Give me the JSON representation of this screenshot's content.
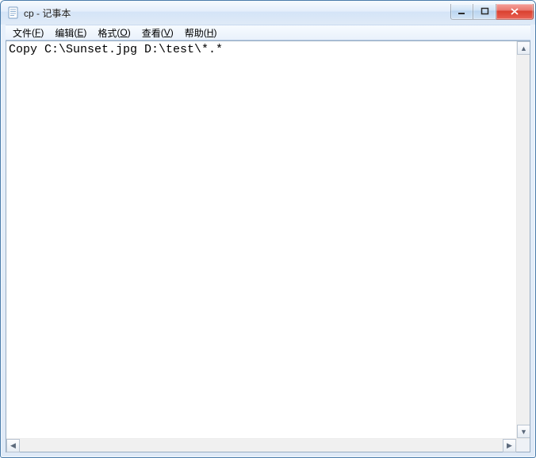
{
  "window": {
    "title": "cp - 记事本"
  },
  "menu": {
    "file": {
      "label": "文件",
      "hotkey": "F"
    },
    "edit": {
      "label": "编辑",
      "hotkey": "E"
    },
    "format": {
      "label": "格式",
      "hotkey": "O"
    },
    "view": {
      "label": "查看",
      "hotkey": "V"
    },
    "help": {
      "label": "帮助",
      "hotkey": "H"
    }
  },
  "editor": {
    "content": "Copy C:\\Sunset.jpg D:\\test\\*.*"
  },
  "icons": {
    "app": "notepad-icon",
    "minimize": "minimize-icon",
    "maximize": "maximize-icon",
    "close": "close-icon",
    "arrow_up": "▲",
    "arrow_down": "▼",
    "arrow_left": "◀",
    "arrow_right": "▶"
  }
}
